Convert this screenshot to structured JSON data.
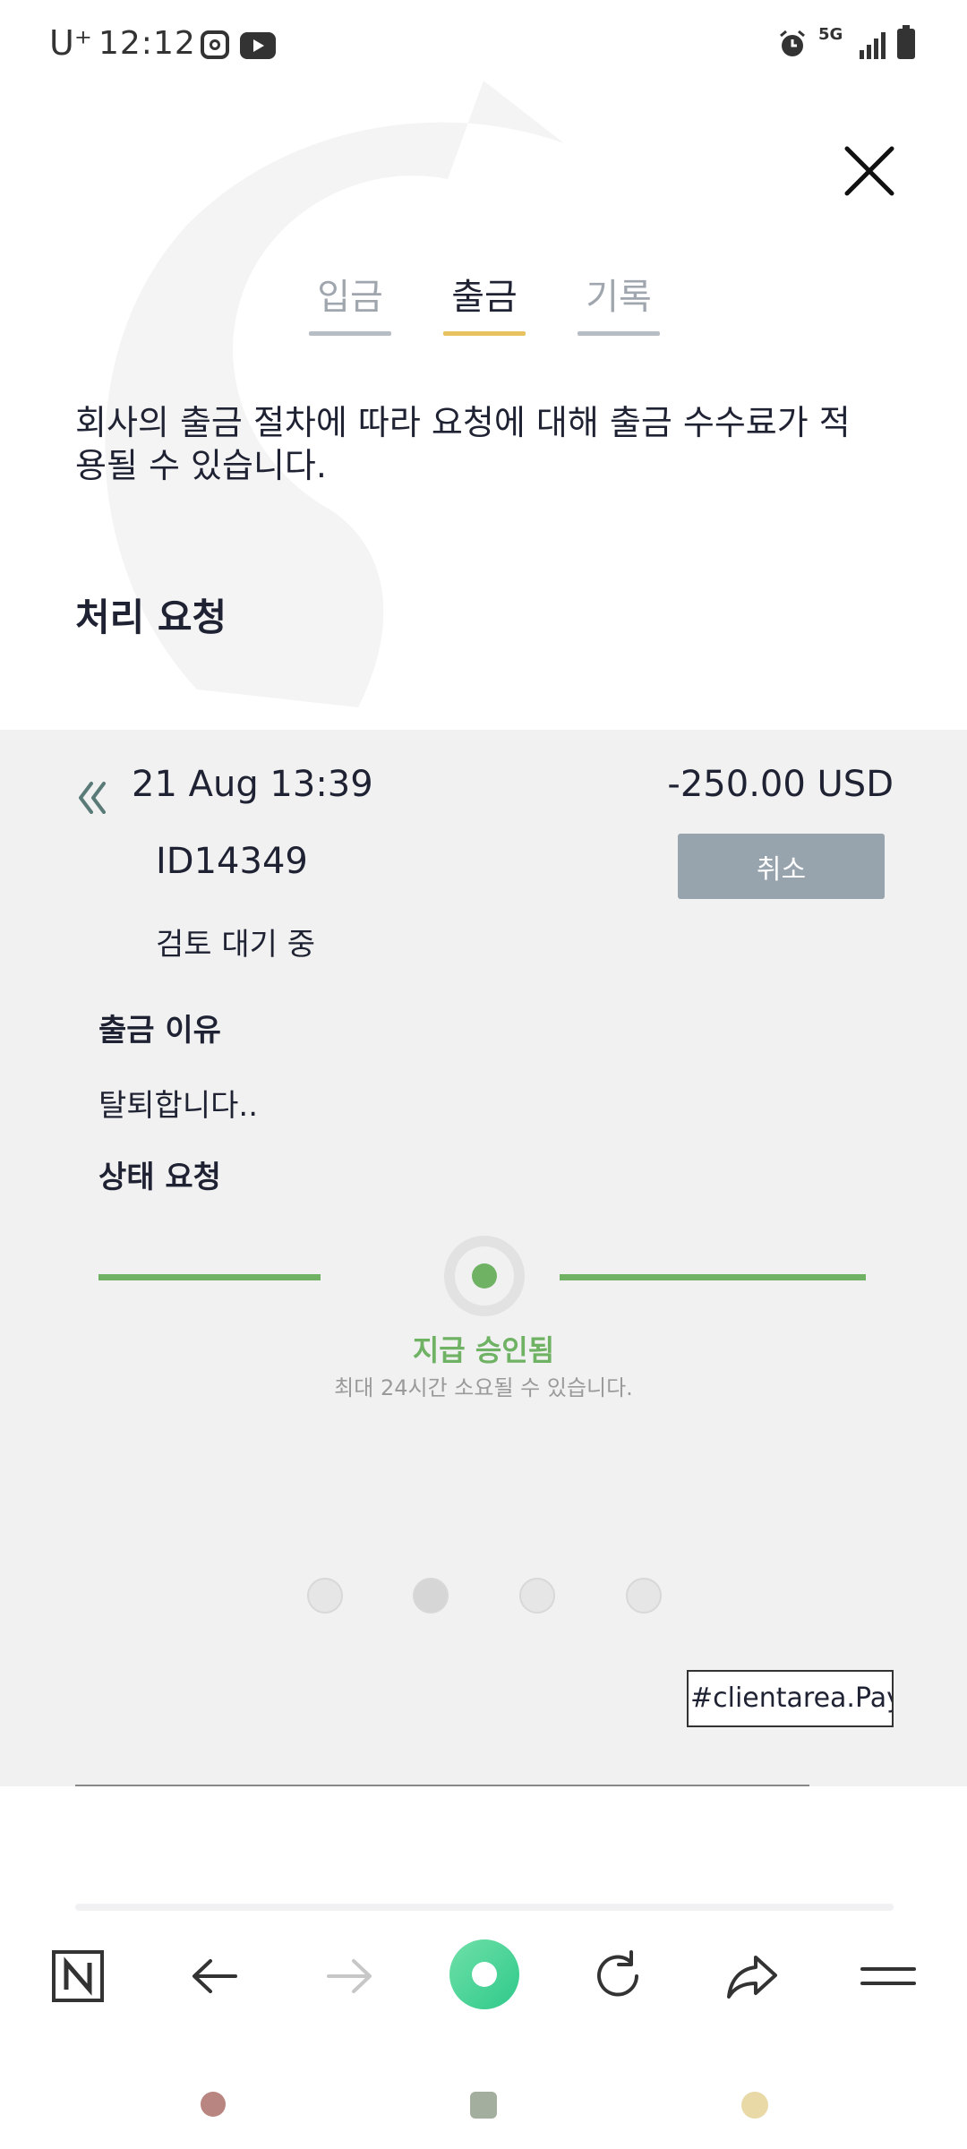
{
  "status_bar": {
    "carrier": "U⁺",
    "time": "12:12",
    "network": "5G"
  },
  "tabs": [
    {
      "label": "입금",
      "active": false
    },
    {
      "label": "출금",
      "active": true
    },
    {
      "label": "기록",
      "active": false
    }
  ],
  "notice": "회사의 출금 절차에 따라 요청에 대해 출금 수수료가 적용될 수 있습니다.",
  "section_title": "처리 요청",
  "request": {
    "date": "21 Aug 13:39",
    "amount": "-250.00 USD",
    "id": "ID14349",
    "cancel_label": "취소",
    "status": "검토 대기 중",
    "reason_label": "출금 이유",
    "reason_value": "탈퇴합니다..",
    "state_label": "상태 요청",
    "progress_title": "지급 승인됨",
    "progress_subtitle": "최대 24시간 소요될 수 있습니다."
  },
  "pager": {
    "count": 4,
    "active_index": 1
  },
  "hash_label": "#clientarea.Payr",
  "colors": {
    "accent_green": "#6fb264",
    "tab_active_underline": "#e8c25e",
    "cancel_button": "#97a3ad",
    "panel_bg": "#f1f1f1"
  },
  "icons": {
    "close": "close-icon",
    "collapse": "double-chevron-left-icon",
    "toolbar": [
      "naver-n-icon",
      "arrow-left-icon",
      "arrow-right-icon",
      "home-circle-icon",
      "reload-icon",
      "share-icon",
      "menu-icon"
    ]
  }
}
